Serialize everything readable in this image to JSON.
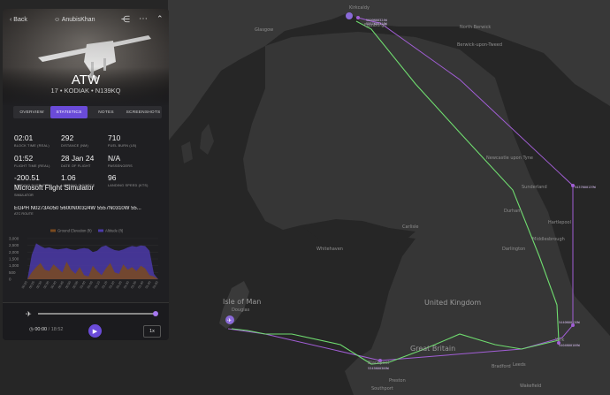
{
  "panel": {
    "back_label": "Back",
    "username": "AnubisKhan",
    "title": "ATW",
    "subtitle": "17 • KODIAK • N139KQ",
    "tabs": [
      {
        "label": "OVERVIEW",
        "active": false
      },
      {
        "label": "STATISTICS",
        "active": true
      },
      {
        "label": "NOTES",
        "active": false
      },
      {
        "label": "SCREENSHOTS",
        "active": false
      }
    ],
    "stats": [
      {
        "value": "02:01",
        "label": "BLOCK TIME (REAL)"
      },
      {
        "value": "292",
        "label": "DISTANCE (NM)"
      },
      {
        "value": "710",
        "label": "FUEL BURN (LB)"
      },
      {
        "value": "01:52",
        "label": "FLIGHT TIME (REAL)"
      },
      {
        "value": "28 Jan 24",
        "label": "DATE OF FLIGHT"
      },
      {
        "value": "N/A",
        "label": "PASSENGERS"
      },
      {
        "value": "-200.51",
        "label": "LANDING RATE (FPM)"
      },
      {
        "value": "1.06",
        "label": "LANDING G-FORCE"
      },
      {
        "value": "96",
        "label": "LANDING SPEED (KTS)"
      }
    ],
    "simulator": {
      "value": "Microsoft Flight Simulator",
      "label": "SIMULATOR"
    },
    "route": {
      "value": "EGPH N0273A050 5600N00324W 5557N0310W 55...",
      "label": "ATC ROUTE"
    }
  },
  "chart_data": {
    "type": "area",
    "series": [
      {
        "name": "Ground Elevation (ft)",
        "color": "#7a4a1e"
      },
      {
        "name": "Altitude (ft)",
        "color": "#4b3aa8"
      }
    ],
    "ylim": [
      0,
      3000
    ],
    "yticks": [
      "3,000",
      "2,500",
      "2,000",
      "1,500",
      "1,000",
      "500",
      "0"
    ],
    "xticks": [
      "00:20",
      "00:25",
      "00:30",
      "00:35",
      "00:40",
      "00:45",
      "00:50",
      "00:55",
      "01:00",
      "01:05",
      "01:10",
      "01:15",
      "01:20",
      "01:25",
      "01:30",
      "01:35",
      "01:40",
      "01:45",
      "01:50"
    ],
    "altitude": [
      0,
      1800,
      2650,
      2450,
      2300,
      2350,
      2250,
      2200,
      2250,
      2300,
      2200,
      2150,
      2250,
      2300,
      2250,
      2000,
      2100,
      2400,
      2500,
      2300,
      2150,
      2100,
      2200,
      2350,
      2450,
      2400,
      2500,
      2450,
      2100,
      400,
      0
    ],
    "ground": [
      0,
      500,
      900,
      1200,
      700,
      600,
      1100,
      800,
      500,
      1300,
      700,
      400,
      900,
      300,
      200,
      1000,
      600,
      300,
      800,
      1200,
      500,
      400,
      1100,
      700,
      900,
      600,
      1000,
      800,
      300,
      200,
      0
    ]
  },
  "player": {
    "time": "00:00",
    "duration": "18:52",
    "speed": "1x"
  },
  "map": {
    "cities": [
      "Glasgow",
      "Edinburgh",
      "Kirkcaldy",
      "North Berwick",
      "Berwick-upon-Tweed",
      "Sunderland",
      "Hartlepool",
      "Middlesbrough",
      "Darlington",
      "York",
      "Blackpool",
      "Preston",
      "Bradford",
      "Leeds",
      "Southport",
      "Wakefield",
      "Douglas",
      "Whitehaven",
      "Carlisle",
      "Newcastle upon Tyne",
      "Durham"
    ],
    "regions": [
      "Isle of Man",
      "United Kingdom",
      "Great Britain"
    ],
    "waypoints": [
      "5600N00324W",
      "5557N00310W",
      "5437N00139W",
      "5440N00130W",
      "5404N00106W",
      "5345N00300W"
    ],
    "route_color": "#6fdc6f",
    "plan_color": "#a25ed6"
  }
}
